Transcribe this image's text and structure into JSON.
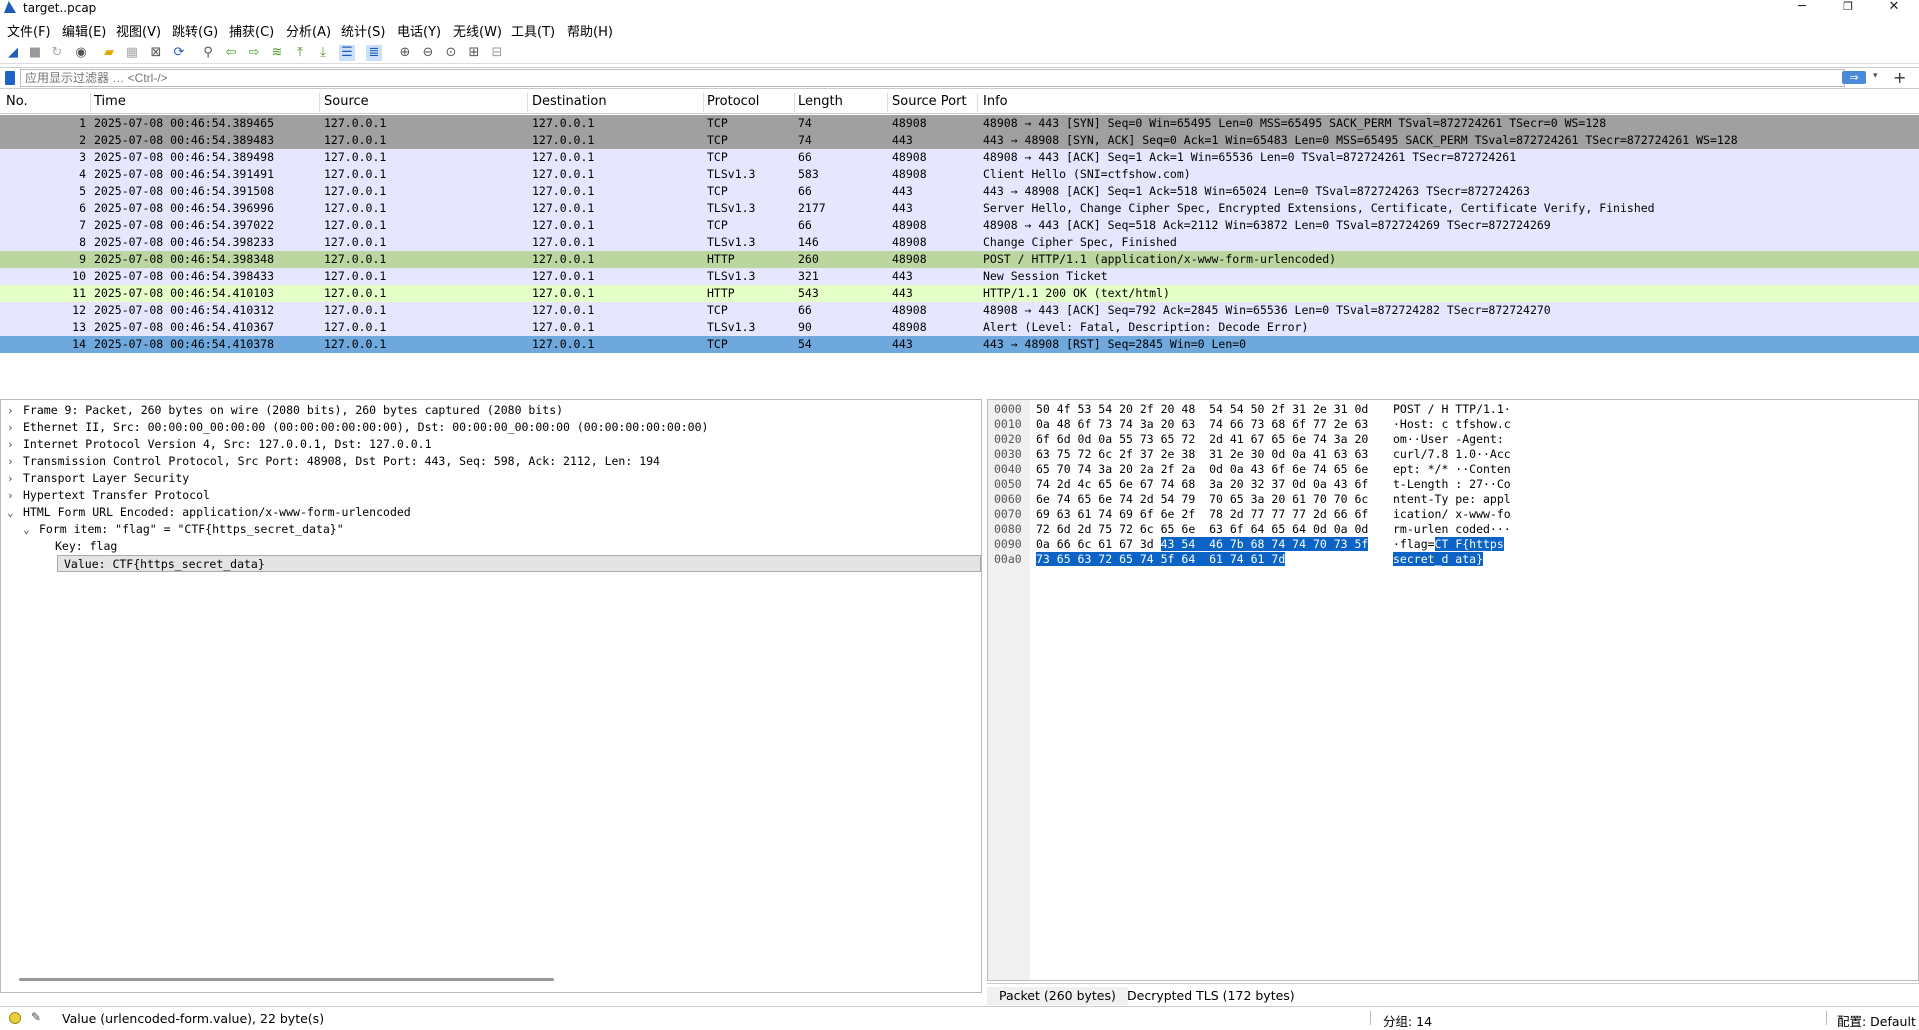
{
  "window": {
    "title": "target..pcap",
    "minimize": "─",
    "restore": "❐",
    "close": "✕"
  },
  "menu": [
    "文件(F)",
    "编辑(E)",
    "视图(V)",
    "跳转(G)",
    "捕获(C)",
    "分析(A)",
    "统计(S)",
    "电话(Y)",
    "无线(W)",
    "工具(T)",
    "帮助(H)"
  ],
  "toolbar_icons": [
    "shark-fin-icon",
    "stop-icon",
    "restart-icon",
    "options-icon",
    "open-file-icon",
    "save-icon",
    "close-file-icon",
    "reload-icon",
    "find-icon",
    "back-icon",
    "forward-icon",
    "goto-icon",
    "first-icon",
    "last-icon",
    "autoscroll-icon",
    "colorize-icon",
    "zoom-in-icon",
    "zoom-out-icon",
    "normal-size-icon",
    "resize-columns-icon",
    "layout-icon"
  ],
  "filter": {
    "placeholder": "应用显示过滤器 … <Ctrl-/>",
    "apply_arrow": "⇒",
    "dropdown": "▾",
    "add": "+"
  },
  "packet_list": {
    "columns": [
      "No.",
      "Time",
      "Source",
      "Destination",
      "Protocol",
      "Length",
      "Source Port",
      "Info"
    ],
    "rows": [
      {
        "no": "1",
        "time": "2025-07-08 00:46:54.389465",
        "src": "127.0.0.1",
        "dst": "127.0.0.1",
        "proto": "TCP",
        "len": "74",
        "sport": "48908",
        "info": "48908 → 443 [SYN] Seq=0 Win=65495 Len=0 MSS=65495 SACK_PERM TSval=872724261 TSecr=0 WS=128",
        "bg": "#a0a0a0",
        "fg": "#000000"
      },
      {
        "no": "2",
        "time": "2025-07-08 00:46:54.389483",
        "src": "127.0.0.1",
        "dst": "127.0.0.1",
        "proto": "TCP",
        "len": "74",
        "sport": "443",
        "info": "443 → 48908 [SYN, ACK] Seq=0 Ack=1 Win=65483 Len=0 MSS=65495 SACK_PERM TSval=872724261 TSecr=872724261 WS=128",
        "bg": "#a0a0a0",
        "fg": "#000000"
      },
      {
        "no": "3",
        "time": "2025-07-08 00:46:54.389498",
        "src": "127.0.0.1",
        "dst": "127.0.0.1",
        "proto": "TCP",
        "len": "66",
        "sport": "48908",
        "info": "48908 → 443 [ACK] Seq=1 Ack=1 Win=65536 Len=0 TSval=872724261 TSecr=872724261",
        "bg": "#e7e6ff",
        "fg": "#000000"
      },
      {
        "no": "4",
        "time": "2025-07-08 00:46:54.391491",
        "src": "127.0.0.1",
        "dst": "127.0.0.1",
        "proto": "TLSv1.3",
        "len": "583",
        "sport": "48908",
        "info": "Client Hello (SNI=ctfshow.com)",
        "bg": "#e7e6ff",
        "fg": "#000000"
      },
      {
        "no": "5",
        "time": "2025-07-08 00:46:54.391508",
        "src": "127.0.0.1",
        "dst": "127.0.0.1",
        "proto": "TCP",
        "len": "66",
        "sport": "443",
        "info": "443 → 48908 [ACK] Seq=1 Ack=518 Win=65024 Len=0 TSval=872724263 TSecr=872724263",
        "bg": "#e7e6ff",
        "fg": "#000000"
      },
      {
        "no": "6",
        "time": "2025-07-08 00:46:54.396996",
        "src": "127.0.0.1",
        "dst": "127.0.0.1",
        "proto": "TLSv1.3",
        "len": "2177",
        "sport": "443",
        "info": "Server Hello, Change Cipher Spec, Encrypted Extensions, Certificate, Certificate Verify, Finished",
        "bg": "#e7e6ff",
        "fg": "#000000"
      },
      {
        "no": "7",
        "time": "2025-07-08 00:46:54.397022",
        "src": "127.0.0.1",
        "dst": "127.0.0.1",
        "proto": "TCP",
        "len": "66",
        "sport": "48908",
        "info": "48908 → 443 [ACK] Seq=518 Ack=2112 Win=63872 Len=0 TSval=872724269 TSecr=872724269",
        "bg": "#e7e6ff",
        "fg": "#000000"
      },
      {
        "no": "8",
        "time": "2025-07-08 00:46:54.398233",
        "src": "127.0.0.1",
        "dst": "127.0.0.1",
        "proto": "TLSv1.3",
        "len": "146",
        "sport": "48908",
        "info": "Change Cipher Spec, Finished",
        "bg": "#e7e6ff",
        "fg": "#000000"
      },
      {
        "no": "9",
        "time": "2025-07-08 00:46:54.398348",
        "src": "127.0.0.1",
        "dst": "127.0.0.1",
        "proto": "HTTP",
        "len": "260",
        "sport": "48908",
        "info": "POST / HTTP/1.1  (application/x-www-form-urlencoded)",
        "bg": "#bcd6a0",
        "fg": "#000000"
      },
      {
        "no": "10",
        "time": "2025-07-08 00:46:54.398433",
        "src": "127.0.0.1",
        "dst": "127.0.0.1",
        "proto": "TLSv1.3",
        "len": "321",
        "sport": "443",
        "info": "New Session Ticket",
        "bg": "#e7e6ff",
        "fg": "#000000"
      },
      {
        "no": "11",
        "time": "2025-07-08 00:46:54.410103",
        "src": "127.0.0.1",
        "dst": "127.0.0.1",
        "proto": "HTTP",
        "len": "543",
        "sport": "443",
        "info": "HTTP/1.1 200 OK  (text/html)",
        "bg": "#e4ffc7",
        "fg": "#000000"
      },
      {
        "no": "12",
        "time": "2025-07-08 00:46:54.410312",
        "src": "127.0.0.1",
        "dst": "127.0.0.1",
        "proto": "TCP",
        "len": "66",
        "sport": "48908",
        "info": "48908 → 443 [ACK] Seq=792 Ack=2845 Win=65536 Len=0 TSval=872724282 TSecr=872724270",
        "bg": "#e7e6ff",
        "fg": "#000000"
      },
      {
        "no": "13",
        "time": "2025-07-08 00:46:54.410367",
        "src": "127.0.0.1",
        "dst": "127.0.0.1",
        "proto": "TLSv1.3",
        "len": "90",
        "sport": "48908",
        "info": "Alert (Level: Fatal, Description: Decode Error)",
        "bg": "#e7e6ff",
        "fg": "#000000"
      },
      {
        "no": "14",
        "time": "2025-07-08 00:46:54.410378",
        "src": "127.0.0.1",
        "dst": "127.0.0.1",
        "proto": "TCP",
        "len": "54",
        "sport": "443",
        "info": "443 → 48908 [RST] Seq=2845 Win=0 Len=0",
        "bg": "#6fa8dc",
        "fg": "#000000"
      }
    ]
  },
  "details": [
    {
      "chev": "›",
      "text": "Frame 9: Packet, 260 bytes on wire (2080 bits), 260 bytes captured (2080 bits)"
    },
    {
      "chev": "›",
      "text": "Ethernet II, Src: 00:00:00_00:00:00 (00:00:00:00:00:00), Dst: 00:00:00_00:00:00 (00:00:00:00:00:00)"
    },
    {
      "chev": "›",
      "text": "Internet Protocol Version 4, Src: 127.0.0.1, Dst: 127.0.0.1"
    },
    {
      "chev": "›",
      "text": "Transmission Control Protocol, Src Port: 48908, Dst Port: 443, Seq: 598, Ack: 2112, Len: 194"
    },
    {
      "chev": "›",
      "text": "Transport Layer Security"
    },
    {
      "chev": "›",
      "text": "Hypertext Transfer Protocol"
    },
    {
      "chev": "⌄",
      "text": "HTML Form URL Encoded: application/x-www-form-urlencoded"
    },
    {
      "chev": "⌄",
      "text": "Form item: \"flag\" = \"CTF{https_secret_data}\""
    },
    {
      "chev": "",
      "text": "Key: flag"
    },
    {
      "chev": "",
      "text": "Value: CTF{https_secret_data}"
    }
  ],
  "bytes": [
    {
      "off": "0000",
      "hex": "50 4f 53 54 20 2f 20 48  54 54 50 2f 31 2e 31 0d",
      "asc": "POST / H TTP/1.1·"
    },
    {
      "off": "0010",
      "hex": "0a 48 6f 73 74 3a 20 63  74 66 73 68 6f 77 2e 63",
      "asc": "·Host: c tfshow.c"
    },
    {
      "off": "0020",
      "hex": "6f 6d 0d 0a 55 73 65 72  2d 41 67 65 6e 74 3a 20",
      "asc": "om··User -Agent: "
    },
    {
      "off": "0030",
      "hex": "63 75 72 6c 2f 37 2e 38  31 2e 30 0d 0a 41 63 63",
      "asc": "curl/7.8 1.0··Acc"
    },
    {
      "off": "0040",
      "hex": "65 70 74 3a 20 2a 2f 2a  0d 0a 43 6f 6e 74 65 6e",
      "asc": "ept: */* ··Conten"
    },
    {
      "off": "0050",
      "hex": "74 2d 4c 65 6e 67 74 68  3a 20 32 37 0d 0a 43 6f",
      "asc": "t-Length : 27··Co"
    },
    {
      "off": "0060",
      "hex": "6e 74 65 6e 74 2d 54 79  70 65 3a 20 61 70 70 6c",
      "asc": "ntent-Ty pe: appl"
    },
    {
      "off": "0070",
      "hex": "69 63 61 74 69 6f 6e 2f  78 2d 77 77 77 2d 66 6f",
      "asc": "ication/ x-www-fo"
    },
    {
      "off": "0080",
      "hex": "72 6d 2d 75 72 6c 65 6e  63 6f 64 65 64 0d 0a 0d",
      "asc": "rm-urlen coded···"
    },
    {
      "off": "0090",
      "hex": "0a 66 6c 61 67 3d ",
      "hexhl": "43 54  46 7b 68 74 74 70 73 5f",
      "asc": "·flag=",
      "aschl": "CT F{https"
    },
    {
      "off": "00a0",
      "hex": "",
      "hexhl": "73 65 63 72 65 74 5f 64  61 74 61 7d",
      "asc": "",
      "aschl": "secret_d ata}"
    }
  ],
  "byte_tabs": [
    "Packet (260 bytes)",
    "Decrypted TLS (172 bytes)"
  ],
  "status": {
    "message": "Value (urlencoded-form.value), 22 byte(s)",
    "group": "分组: 14",
    "profile": "配置: Default"
  }
}
